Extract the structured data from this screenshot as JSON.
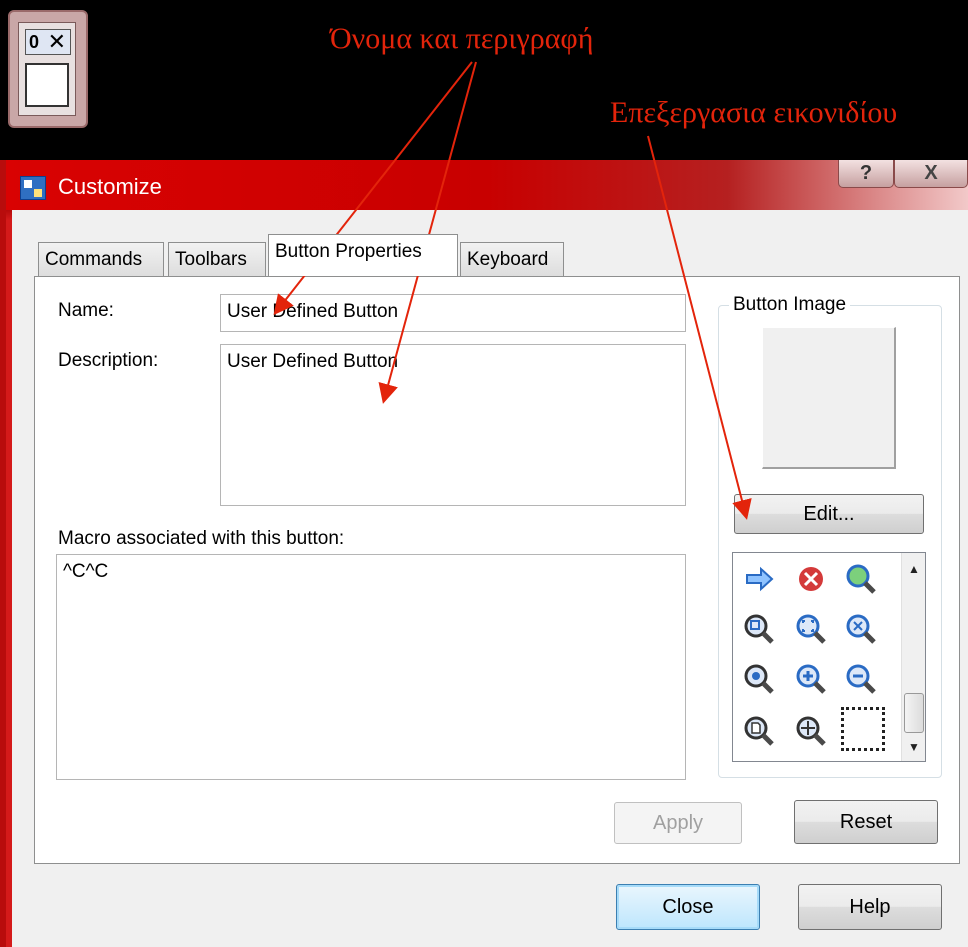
{
  "mini_toolbar": {
    "number": "0",
    "close_glyph": "✕"
  },
  "annotations": {
    "name_description": "Όνομα και περιγραφή",
    "edit_icon": "Επεξεργασια εικονιδίου",
    "color": "#e3240b"
  },
  "window": {
    "title": "Customize",
    "help_glyph": "?",
    "close_glyph": "X"
  },
  "tabs": [
    {
      "label": "Commands",
      "active": false
    },
    {
      "label": "Toolbars",
      "active": false
    },
    {
      "label": "Button Properties",
      "active": true
    },
    {
      "label": "Keyboard",
      "active": false
    }
  ],
  "form": {
    "name_label": "Name:",
    "name_value": "User Defined Button",
    "description_label": "Description:",
    "description_value": "User Defined Button",
    "macro_label": "Macro associated with this button:",
    "macro_value": "^C^C"
  },
  "button_image": {
    "group_label": "Button Image",
    "edit_label": "Edit...",
    "icons": [
      "arrow-right-icon",
      "cancel-icon",
      "zoom-realtime-icon",
      "zoom-window-icon",
      "zoom-extents-icon",
      "zoom-all-icon",
      "zoom-center-icon",
      "zoom-in-icon",
      "zoom-out-icon",
      "zoom-previous-icon",
      "pan-icon",
      "blank-icon-selected"
    ]
  },
  "buttons": {
    "apply": "Apply",
    "reset": "Reset",
    "close": "Close",
    "help": "Help"
  }
}
